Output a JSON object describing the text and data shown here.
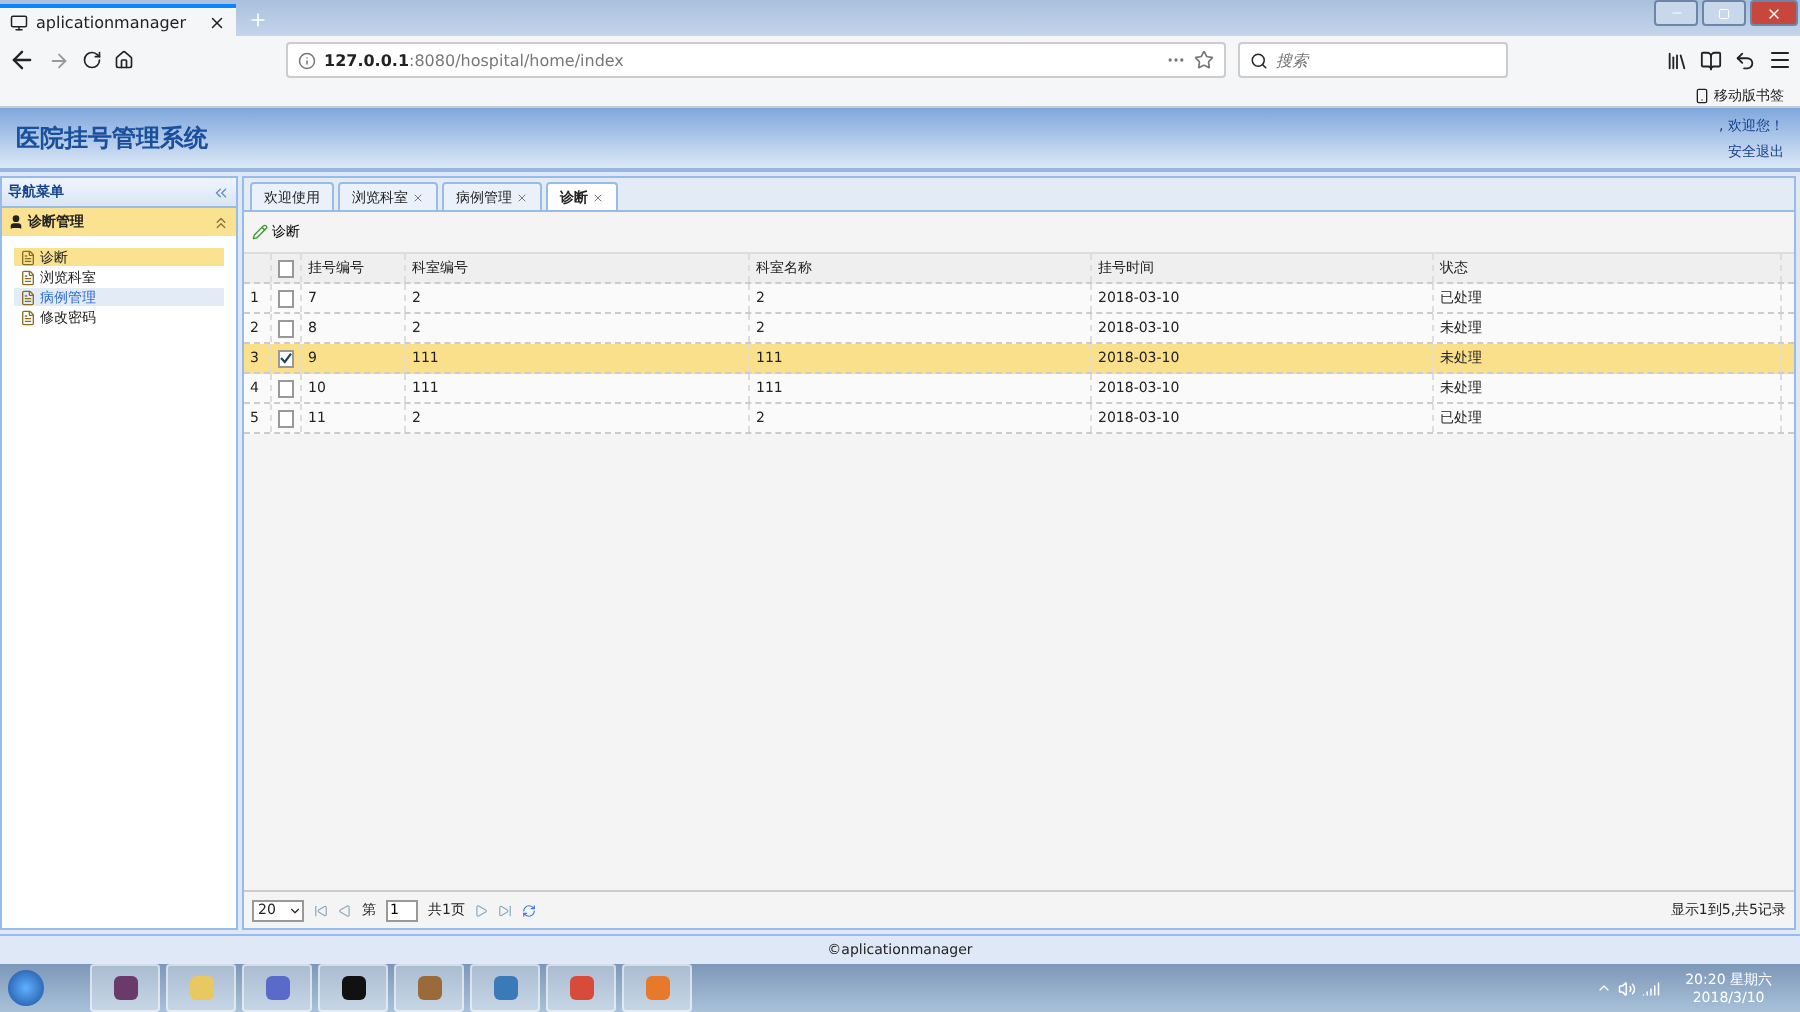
{
  "browser": {
    "tab_title": "aplicationmanager",
    "url_host": "127.0.0.1",
    "url_rest": ":8080/hospital/home/index",
    "search_placeholder": "搜索",
    "bookmark": "移动版书签"
  },
  "header": {
    "title": "医院挂号管理系统",
    "welcome": ", 欢迎您！",
    "logout": "安全退出"
  },
  "sidebar": {
    "title": "导航菜单",
    "section": "诊断管理",
    "items": [
      {
        "label": "诊断",
        "selected": true,
        "hovered": false
      },
      {
        "label": "浏览科室",
        "selected": false,
        "hovered": false
      },
      {
        "label": "病例管理",
        "selected": false,
        "hovered": true
      },
      {
        "label": "修改密码",
        "selected": false,
        "hovered": false
      }
    ]
  },
  "tabs": [
    {
      "label": "欢迎使用",
      "closable": false,
      "selected": false
    },
    {
      "label": "浏览科室",
      "closable": true,
      "selected": false
    },
    {
      "label": "病例管理",
      "closable": true,
      "selected": false
    },
    {
      "label": "诊断",
      "closable": true,
      "selected": true
    }
  ],
  "toolbar": {
    "button": "诊断"
  },
  "table": {
    "all_checked": false,
    "columns": [
      "挂号编号",
      "科室编号",
      "科室名称",
      "挂号时间",
      "状态"
    ],
    "rows": [
      {
        "number": "1",
        "checked": false,
        "selected": false,
        "cells": [
          "7",
          "2",
          "2",
          "2018-03-10",
          "已处理"
        ]
      },
      {
        "number": "2",
        "checked": false,
        "selected": false,
        "cells": [
          "8",
          "2",
          "2",
          "2018-03-10",
          "未处理"
        ]
      },
      {
        "number": "3",
        "checked": true,
        "selected": true,
        "cells": [
          "9",
          "111",
          "111",
          "2018-03-10",
          "未处理"
        ]
      },
      {
        "number": "4",
        "checked": false,
        "selected": false,
        "cells": [
          "10",
          "111",
          "111",
          "2018-03-10",
          "未处理"
        ]
      },
      {
        "number": "5",
        "checked": false,
        "selected": false,
        "cells": [
          "11",
          "2",
          "2",
          "2018-03-10",
          "已处理"
        ]
      }
    ]
  },
  "pager": {
    "page_size": "20",
    "page_prefix": "第",
    "page": "1",
    "total_pages": "共1页",
    "summary": "显示1到5,共5记录"
  },
  "footer": "©aplicationmanager",
  "taskbar": {
    "time": "20:20 星期六",
    "date": "2018/3/10"
  }
}
